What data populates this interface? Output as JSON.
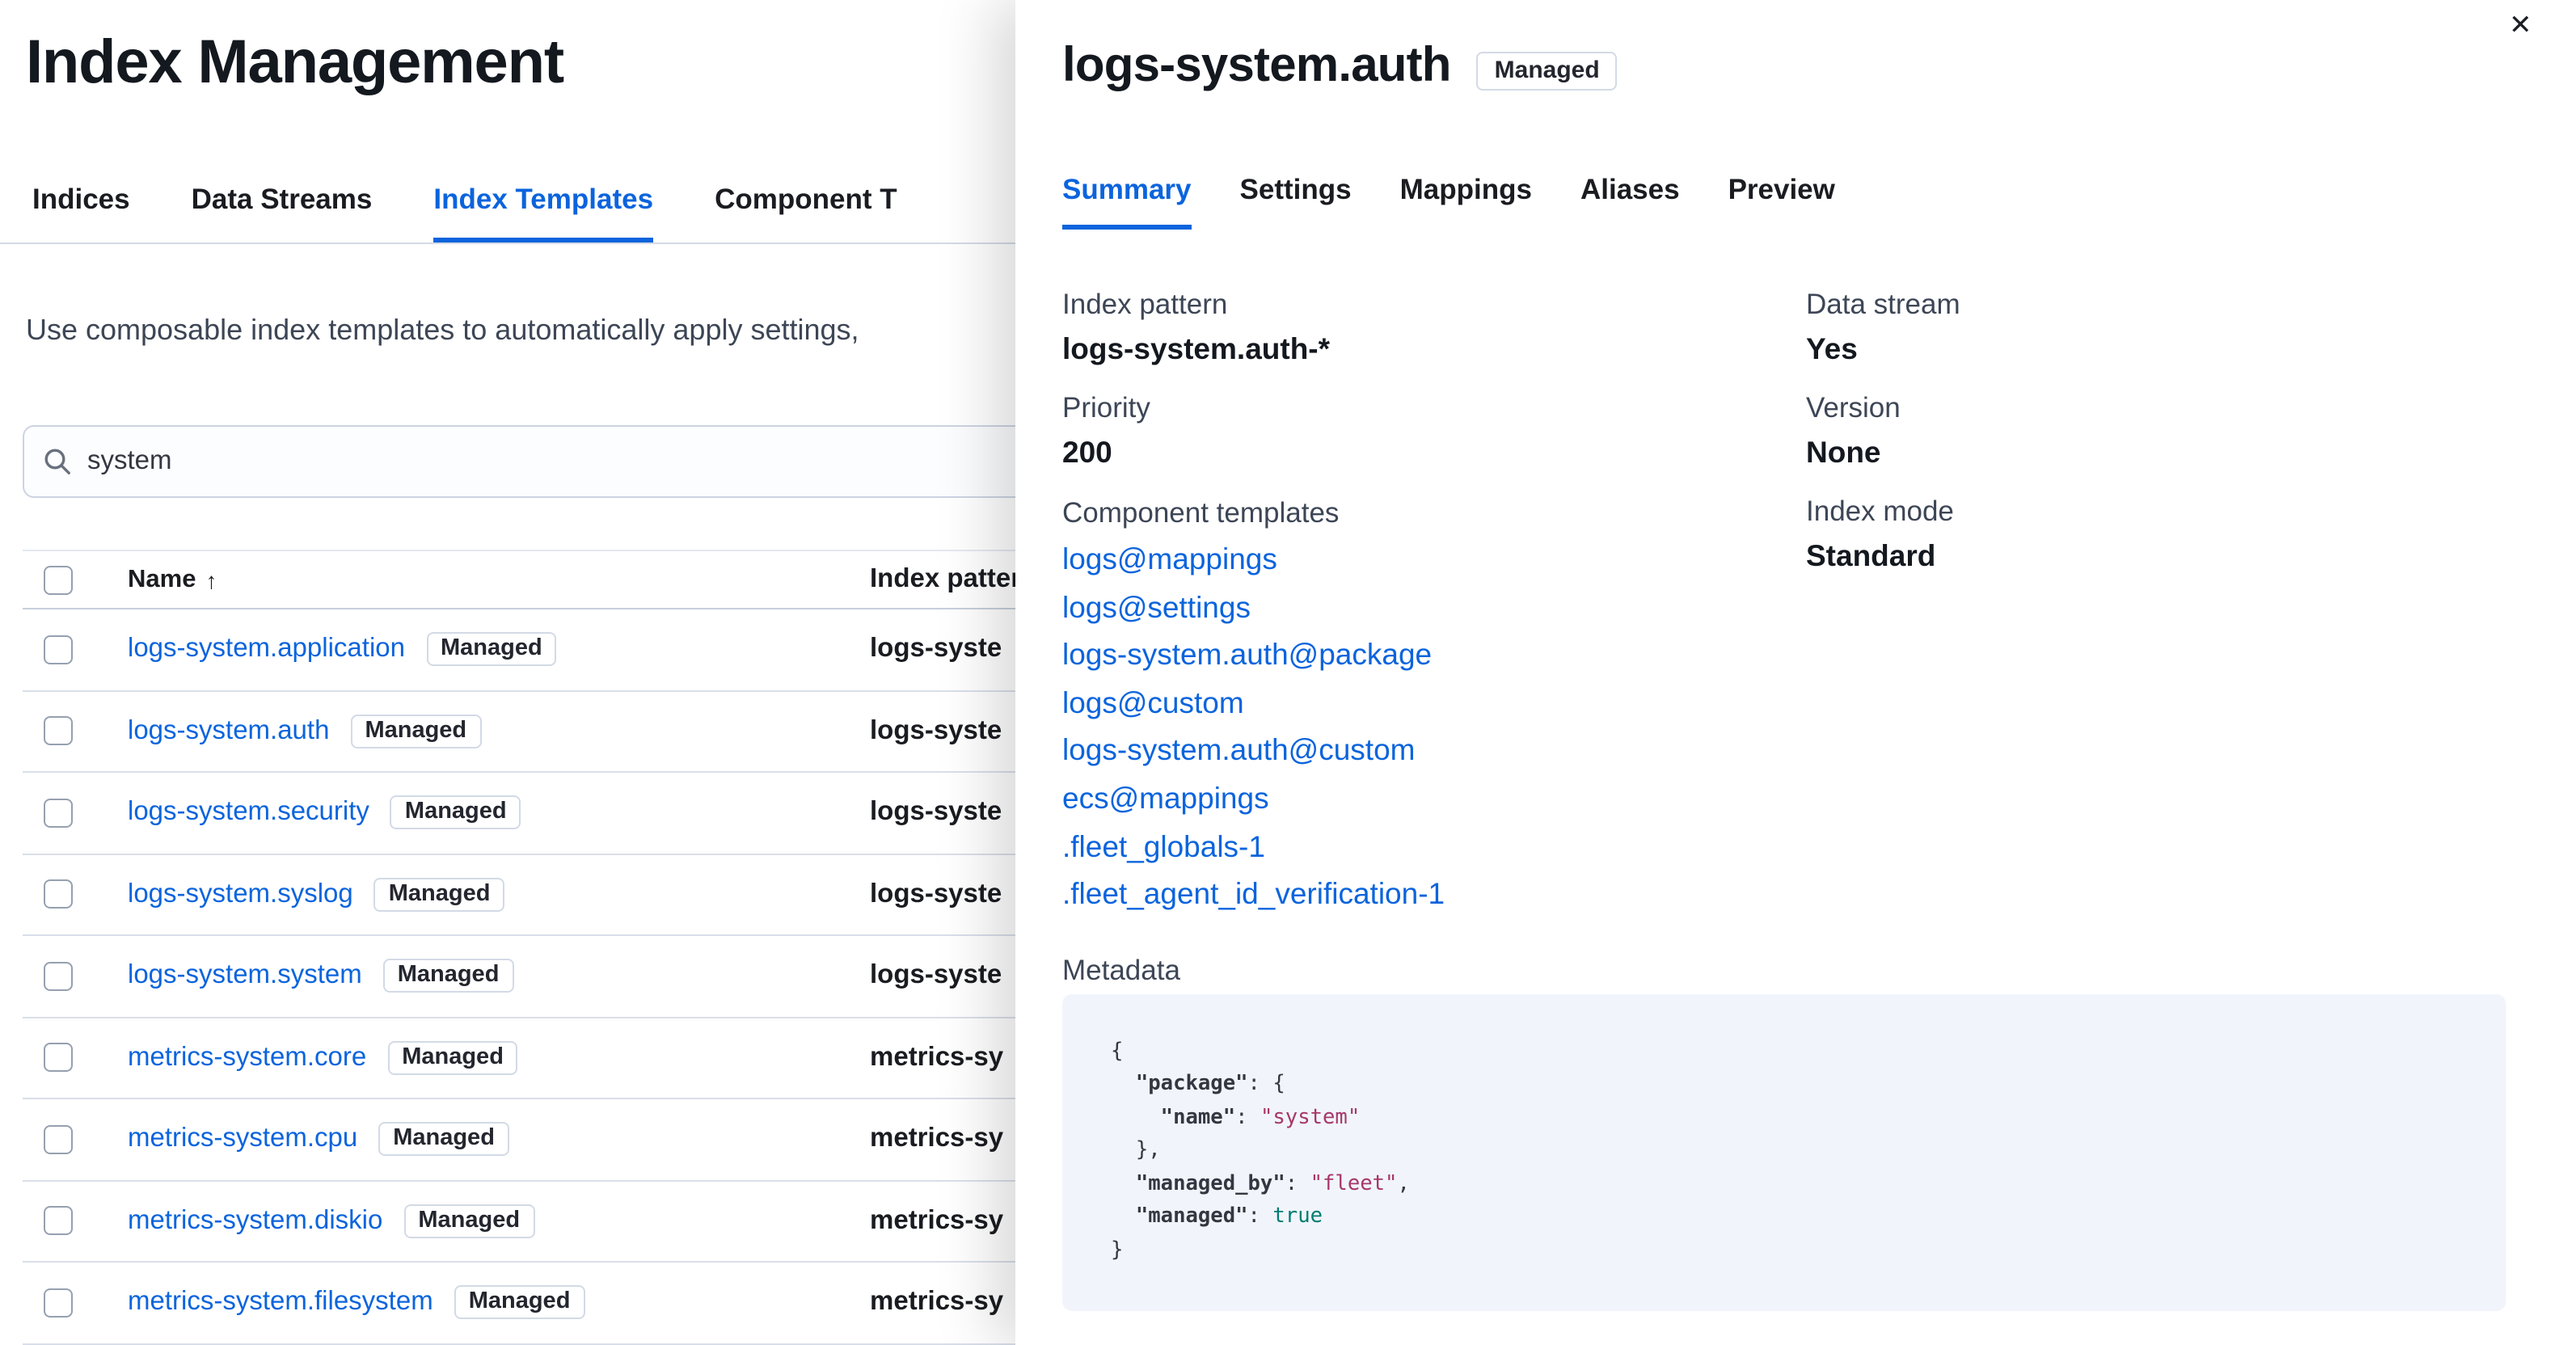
{
  "colors": {
    "primary": "#0b64dd",
    "text": "#1a1c21",
    "subdued_text": "#3d4656",
    "border": "#d3dae6",
    "code_background": "#f1f5fb",
    "code_string": "#a8376a",
    "code_boolean": "#017d73"
  },
  "page": {
    "title": "Index Management",
    "tabs": [
      {
        "label": "Indices",
        "selected": false
      },
      {
        "label": "Data Streams",
        "selected": false
      },
      {
        "label": "Index Templates",
        "selected": true
      },
      {
        "label": "Component T",
        "selected": false
      }
    ],
    "description": "Use composable index templates to automatically apply settings,",
    "search": {
      "value": "system"
    },
    "table": {
      "columns": {
        "name": "Name",
        "index_patterns": "Index patter"
      },
      "sort_arrow": "↑",
      "rows": [
        {
          "name": "logs-system.application",
          "badge": "Managed",
          "pattern": "logs-syste"
        },
        {
          "name": "logs-system.auth",
          "badge": "Managed",
          "pattern": "logs-syste"
        },
        {
          "name": "logs-system.security",
          "badge": "Managed",
          "pattern": "logs-syste"
        },
        {
          "name": "logs-system.syslog",
          "badge": "Managed",
          "pattern": "logs-syste"
        },
        {
          "name": "logs-system.system",
          "badge": "Managed",
          "pattern": "logs-syste"
        },
        {
          "name": "metrics-system.core",
          "badge": "Managed",
          "pattern": "metrics-sy"
        },
        {
          "name": "metrics-system.cpu",
          "badge": "Managed",
          "pattern": "metrics-sy"
        },
        {
          "name": "metrics-system.diskio",
          "badge": "Managed",
          "pattern": "metrics-sy"
        },
        {
          "name": "metrics-system.filesystem",
          "badge": "Managed",
          "pattern": "metrics-sy"
        }
      ]
    }
  },
  "flyout": {
    "title": "logs-system.auth",
    "badge": "Managed",
    "close_icon": "✕",
    "tabs": [
      {
        "label": "Summary",
        "selected": true
      },
      {
        "label": "Settings",
        "selected": false
      },
      {
        "label": "Mappings",
        "selected": false
      },
      {
        "label": "Aliases",
        "selected": false
      },
      {
        "label": "Preview",
        "selected": false
      }
    ],
    "summary": {
      "left": [
        {
          "label": "Index pattern",
          "value": "logs-system.auth-*"
        },
        {
          "label": "Priority",
          "value": "200"
        }
      ],
      "right": [
        {
          "label": "Data stream",
          "value": "Yes"
        },
        {
          "label": "Version",
          "value": "None"
        },
        {
          "label": "Index mode",
          "value": "Standard"
        }
      ],
      "component_templates_label": "Component templates",
      "component_templates": [
        "logs@mappings",
        "logs@settings",
        "logs-system.auth@package",
        "logs@custom",
        "logs-system.auth@custom",
        "ecs@mappings",
        ".fleet_globals-1",
        ".fleet_agent_id_verification-1"
      ],
      "metadata_label": "Metadata",
      "metadata_code": [
        [
          {
            "c": "p",
            "t": "{"
          }
        ],
        [
          {
            "c": "p",
            "t": "  "
          },
          {
            "c": "k",
            "t": "\"package\""
          },
          {
            "c": "p",
            "t": ": {"
          }
        ],
        [
          {
            "c": "p",
            "t": "    "
          },
          {
            "c": "k",
            "t": "\"name\""
          },
          {
            "c": "p",
            "t": ": "
          },
          {
            "c": "s",
            "t": "\"system\""
          }
        ],
        [
          {
            "c": "p",
            "t": "  },"
          }
        ],
        [
          {
            "c": "p",
            "t": "  "
          },
          {
            "c": "k",
            "t": "\"managed_by\""
          },
          {
            "c": "p",
            "t": ": "
          },
          {
            "c": "s",
            "t": "\"fleet\""
          },
          {
            "c": "p",
            "t": ","
          }
        ],
        [
          {
            "c": "p",
            "t": "  "
          },
          {
            "c": "k",
            "t": "\"managed\""
          },
          {
            "c": "p",
            "t": ": "
          },
          {
            "c": "b",
            "t": "true"
          }
        ],
        [
          {
            "c": "p",
            "t": "}"
          }
        ]
      ]
    }
  }
}
